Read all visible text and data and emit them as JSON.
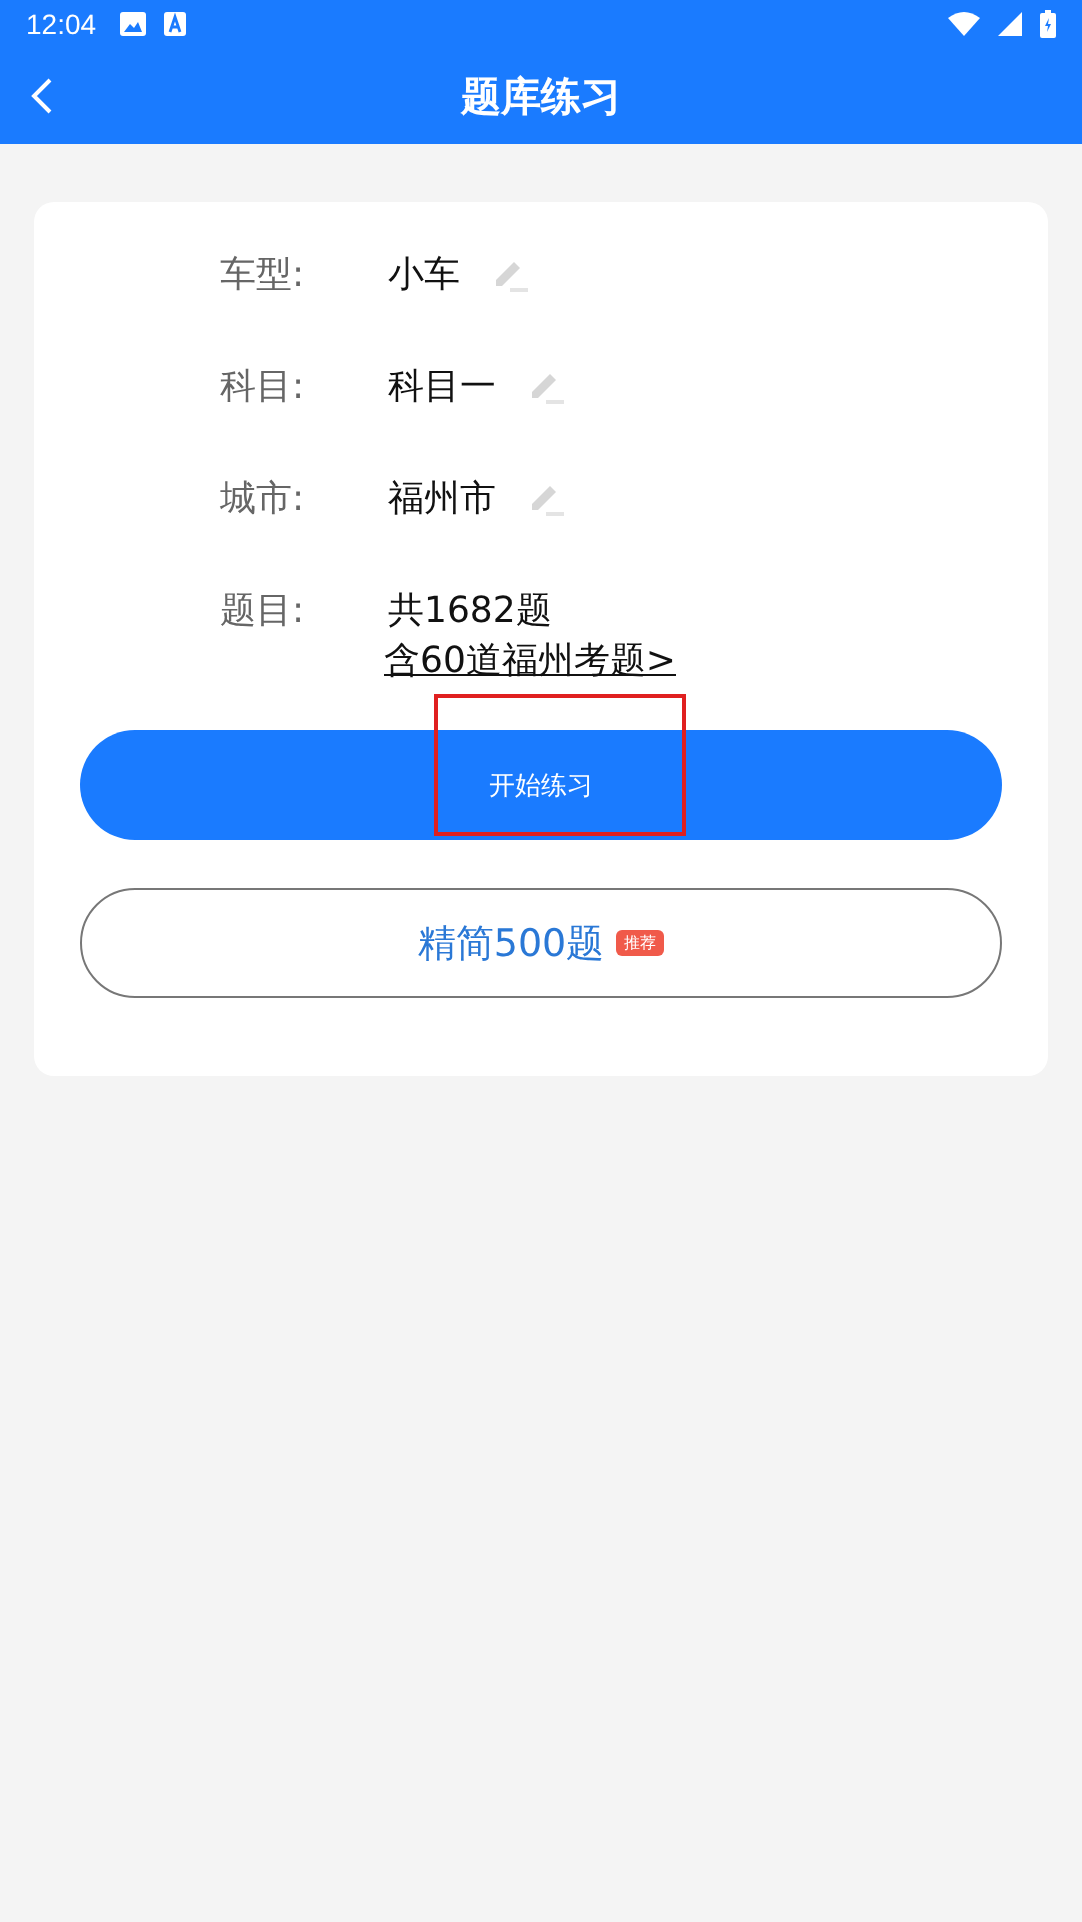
{
  "status_bar": {
    "time": "12:04"
  },
  "app_bar": {
    "title": "题库练习"
  },
  "rows": [
    {
      "label": "车型:",
      "value": "小车",
      "editable": true
    },
    {
      "label": "科目:",
      "value": "科目一",
      "editable": true
    },
    {
      "label": "城市:",
      "value": "福州市",
      "editable": true
    },
    {
      "label": "题目:",
      "value": "共1682题",
      "editable": false,
      "link": "含60道福州考题>"
    }
  ],
  "start_button": {
    "label": "开始练习",
    "highlighted": true
  },
  "lite_button": {
    "label": "精简500题",
    "badge": "推荐"
  }
}
